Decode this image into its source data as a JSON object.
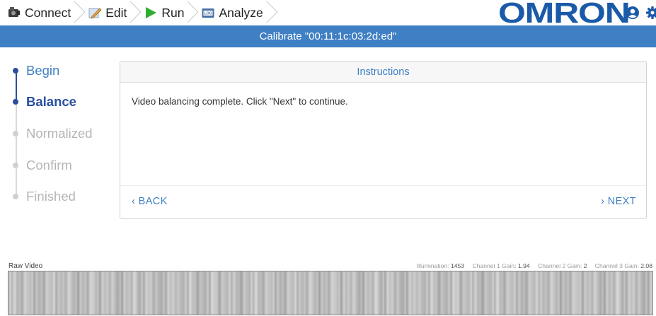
{
  "nav": {
    "crumbs": [
      {
        "label": "Connect",
        "icon": "camera-icon"
      },
      {
        "label": "Edit",
        "icon": "edit-icon"
      },
      {
        "label": "Run",
        "icon": "play-icon"
      },
      {
        "label": "Analyze",
        "icon": "log-icon"
      }
    ],
    "brand": "OMRON",
    "run_color": "#2fae2f",
    "brand_color": "#1b5aa8"
  },
  "title": "Calibrate \"00:11:1c:03:2d:ed\"",
  "steps": [
    {
      "label": "Begin",
      "state": "done"
    },
    {
      "label": "Balance",
      "state": "active"
    },
    {
      "label": "Normalized",
      "state": "pending"
    },
    {
      "label": "Confirm",
      "state": "pending"
    },
    {
      "label": "Finished",
      "state": "pending"
    }
  ],
  "panel": {
    "heading": "Instructions",
    "message": "Video balancing complete. Click \"Next\" to continue.",
    "back_label": "‹ BACK",
    "next_label": "› NEXT"
  },
  "video": {
    "label": "Raw Video",
    "stats": {
      "illumination_label": "Illumination:",
      "illumination": "1453",
      "ch1_label": "Channel 1 Gain:",
      "ch1": "1.94",
      "ch2_label": "Channel 2 Gain:",
      "ch2": "2",
      "ch3_label": "Channel 3 Gain:",
      "ch3": "2.08"
    }
  },
  "colors": {
    "accent": "#3f7fc4",
    "step_active": "#2a4fa0"
  }
}
